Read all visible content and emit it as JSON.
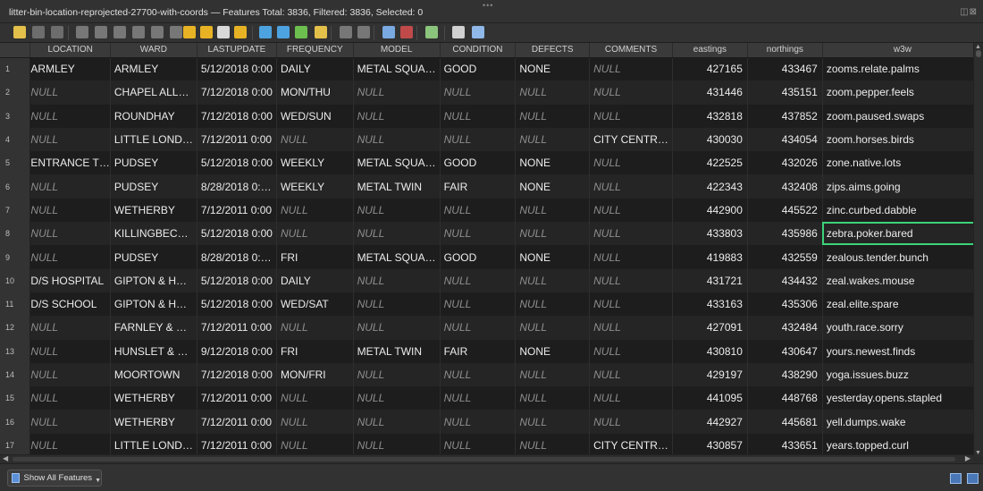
{
  "window": {
    "title": "litter-bin-location-reprojected-27700-with-coords — Features Total: 3836, Filtered: 3836, Selected: 0"
  },
  "toolbar": {
    "icons": [
      {
        "name": "toggle-editing-icon",
        "color": "#e3c04a"
      },
      {
        "name": "multi-edit-icon",
        "color": "#6d6d6d"
      },
      {
        "name": "save-edits-icon",
        "color": "#6d6d6d"
      },
      {
        "name": "reload-icon",
        "color": "#777"
      },
      {
        "name": "add-feature-icon",
        "color": "#777"
      },
      {
        "name": "delete-feature-icon",
        "color": "#777"
      },
      {
        "name": "cut-icon",
        "color": "#777"
      },
      {
        "name": "copy-icon",
        "color": "#777"
      },
      {
        "name": "paste-icon",
        "color": "#777"
      },
      {
        "name": "expression-select-icon",
        "color": "#e7b325"
      },
      {
        "name": "select-all-icon",
        "color": "#e7b325"
      },
      {
        "name": "invert-selection-icon",
        "color": "#d9d9d9"
      },
      {
        "name": "deselect-all-icon",
        "color": "#e7b325"
      },
      {
        "name": "filter-select-icon",
        "color": "#4da3e0"
      },
      {
        "name": "move-selection-top-icon",
        "color": "#4da3e0"
      },
      {
        "name": "pan-to-selected-icon",
        "color": "#6cbf4e"
      },
      {
        "name": "zoom-to-selected-icon",
        "color": "#e3c04a"
      },
      {
        "name": "new-field-icon",
        "color": "#777"
      },
      {
        "name": "delete-field-icon",
        "color": "#777"
      },
      {
        "name": "field-calculator-icon",
        "color": "#7aa8e0"
      },
      {
        "name": "conditional-formatting-icon",
        "color": "#c04a4a"
      },
      {
        "name": "organize-columns-icon",
        "color": "#8bc47c"
      },
      {
        "name": "dock-icon",
        "color": "#d0d0d0"
      },
      {
        "name": "actions-icon",
        "color": "#8fb8e8"
      }
    ]
  },
  "table": {
    "columns": [
      "LOCATION",
      "WARD",
      "LASTUPDATE",
      "FREQUENCY",
      "MODEL",
      "CONDITION",
      "DEFECTS",
      "COMMENTS",
      "eastings",
      "northings",
      "w3w"
    ],
    "rows": [
      {
        "num": "1",
        "location": "ARMLEY",
        "ward": "ARMLEY",
        "lastupdate": "5/12/2018 0:00",
        "frequency": "DAILY",
        "model": "METAL SQUA…",
        "condition": "GOOD",
        "defects": "NONE",
        "comments": "NULL",
        "eastings": "427165",
        "northings": "433467",
        "w3w": "zooms.relate.palms"
      },
      {
        "num": "2",
        "location": "NULL",
        "ward": "CHAPEL ALL…",
        "lastupdate": "7/12/2018 0:00",
        "frequency": "MON/THU",
        "model": "NULL",
        "condition": "NULL",
        "defects": "NULL",
        "comments": "NULL",
        "eastings": "431446",
        "northings": "435151",
        "w3w": "zoom.pepper.feels"
      },
      {
        "num": "3",
        "location": "NULL",
        "ward": "ROUNDHAY",
        "lastupdate": "7/12/2018 0:00",
        "frequency": "WED/SUN",
        "model": "NULL",
        "condition": "NULL",
        "defects": "NULL",
        "comments": "NULL",
        "eastings": "432818",
        "northings": "437852",
        "w3w": "zoom.paused.swaps"
      },
      {
        "num": "4",
        "location": "NULL",
        "ward": "LITTLE LOND…",
        "lastupdate": "7/12/2011 0:00",
        "frequency": "NULL",
        "model": "NULL",
        "condition": "NULL",
        "defects": "NULL",
        "comments": "CITY CENTR…",
        "eastings": "430030",
        "northings": "434054",
        "w3w": "zoom.horses.birds"
      },
      {
        "num": "5",
        "location": "ENTRANCE T…",
        "ward": "PUDSEY",
        "lastupdate": "5/12/2018 0:00",
        "frequency": "WEEKLY",
        "model": "METAL SQUA…",
        "condition": "GOOD",
        "defects": "NONE",
        "comments": "NULL",
        "eastings": "422525",
        "northings": "432026",
        "w3w": "zone.native.lots"
      },
      {
        "num": "6",
        "location": "NULL",
        "ward": "PUDSEY",
        "lastupdate": "8/28/2018 0:…",
        "frequency": "WEEKLY",
        "model": "METAL TWIN",
        "condition": "FAIR",
        "defects": "NONE",
        "comments": "NULL",
        "eastings": "422343",
        "northings": "432408",
        "w3w": "zips.aims.going"
      },
      {
        "num": "7",
        "location": "NULL",
        "ward": "WETHERBY",
        "lastupdate": "7/12/2011 0:00",
        "frequency": "NULL",
        "model": "NULL",
        "condition": "NULL",
        "defects": "NULL",
        "comments": "NULL",
        "eastings": "442900",
        "northings": "445522",
        "w3w": "zinc.curbed.dabble"
      },
      {
        "num": "8",
        "location": "NULL",
        "ward": "KILLINGBEC…",
        "lastupdate": "5/12/2018 0:00",
        "frequency": "NULL",
        "model": "NULL",
        "condition": "NULL",
        "defects": "NULL",
        "comments": "NULL",
        "eastings": "433803",
        "northings": "435986",
        "w3w": "zebra.poker.bared"
      },
      {
        "num": "9",
        "location": "NULL",
        "ward": "PUDSEY",
        "lastupdate": "8/28/2018 0:…",
        "frequency": "FRI",
        "model": "METAL SQUA…",
        "condition": "GOOD",
        "defects": "NONE",
        "comments": "NULL",
        "eastings": "419883",
        "northings": "432559",
        "w3w": "zealous.tender.bunch"
      },
      {
        "num": "10",
        "location": "D/S HOSPITAL",
        "ward": "GIPTON & H…",
        "lastupdate": "5/12/2018 0:00",
        "frequency": "DAILY",
        "model": "NULL",
        "condition": "NULL",
        "defects": "NULL",
        "comments": "NULL",
        "eastings": "431721",
        "northings": "434432",
        "w3w": "zeal.wakes.mouse"
      },
      {
        "num": "11",
        "location": "D/S SCHOOL",
        "ward": "GIPTON & H…",
        "lastupdate": "5/12/2018 0:00",
        "frequency": "WED/SAT",
        "model": "NULL",
        "condition": "NULL",
        "defects": "NULL",
        "comments": "NULL",
        "eastings": "433163",
        "northings": "435306",
        "w3w": "zeal.elite.spare"
      },
      {
        "num": "12",
        "location": "NULL",
        "ward": "FARNLEY & …",
        "lastupdate": "7/12/2011 0:00",
        "frequency": "NULL",
        "model": "NULL",
        "condition": "NULL",
        "defects": "NULL",
        "comments": "NULL",
        "eastings": "427091",
        "northings": "432484",
        "w3w": "youth.race.sorry"
      },
      {
        "num": "13",
        "location": "NULL",
        "ward": "HUNSLET & …",
        "lastupdate": "9/12/2018 0:00",
        "frequency": "FRI",
        "model": "METAL TWIN",
        "condition": "FAIR",
        "defects": "NONE",
        "comments": "NULL",
        "eastings": "430810",
        "northings": "430647",
        "w3w": "yours.newest.finds"
      },
      {
        "num": "14",
        "location": "NULL",
        "ward": "MOORTOWN",
        "lastupdate": "7/12/2018 0:00",
        "frequency": "MON/FRI",
        "model": "NULL",
        "condition": "NULL",
        "defects": "NULL",
        "comments": "NULL",
        "eastings": "429197",
        "northings": "438290",
        "w3w": "yoga.issues.buzz"
      },
      {
        "num": "15",
        "location": "NULL",
        "ward": "WETHERBY",
        "lastupdate": "7/12/2011 0:00",
        "frequency": "NULL",
        "model": "NULL",
        "condition": "NULL",
        "defects": "NULL",
        "comments": "NULL",
        "eastings": "441095",
        "northings": "448768",
        "w3w": "yesterday.opens.stapled"
      },
      {
        "num": "16",
        "location": "NULL",
        "ward": "WETHERBY",
        "lastupdate": "7/12/2011 0:00",
        "frequency": "NULL",
        "model": "NULL",
        "condition": "NULL",
        "defects": "NULL",
        "comments": "NULL",
        "eastings": "442927",
        "northings": "445681",
        "w3w": "yell.dumps.wake"
      },
      {
        "num": "17",
        "location": "NULL",
        "ward": "LITTLE LOND…",
        "lastupdate": "7/12/2011 0:00",
        "frequency": "NULL",
        "model": "NULL",
        "condition": "NULL",
        "defects": "NULL",
        "comments": "CITY CENTR…",
        "eastings": "430857",
        "northings": "433651",
        "w3w": "years.topped.curl"
      }
    ],
    "selected_cell": {
      "row": 8,
      "column": "w3w"
    }
  },
  "statusbar": {
    "filter_button_label": "Show All Features"
  }
}
